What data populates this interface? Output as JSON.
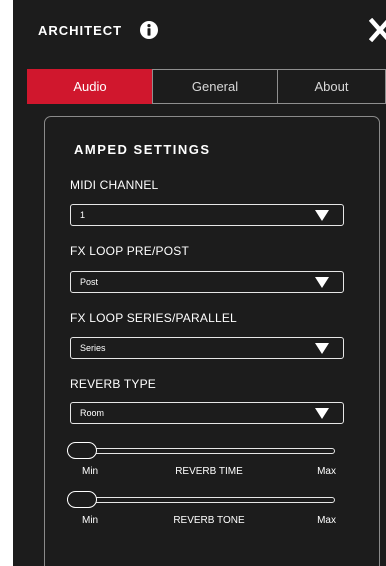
{
  "header": {
    "title": "ARCHITECT",
    "info_icon": "info-icon",
    "close_icon": "close-icon"
  },
  "tabs": [
    {
      "label": "Audio",
      "active": true
    },
    {
      "label": "General",
      "active": false
    },
    {
      "label": "About",
      "active": false
    }
  ],
  "colors": {
    "accent": "#d0172d",
    "background": "#1c1c1c",
    "border": "#8a8a8a",
    "text": "#ffffff"
  },
  "section": {
    "title": "AMPED SETTINGS",
    "fields": [
      {
        "label": "MIDI CHANNEL",
        "value": "1"
      },
      {
        "label": "FX LOOP PRE/POST",
        "value": "Post"
      },
      {
        "label": "FX LOOP SERIES/PARALLEL",
        "value": "Series"
      },
      {
        "label": "REVERB TYPE",
        "value": "Room"
      }
    ],
    "sliders": [
      {
        "label": "REVERB TIME",
        "min_label": "Min",
        "max_label": "Max",
        "level": 0
      },
      {
        "label": "REVERB TONE",
        "min_label": "Min",
        "max_label": "Max",
        "level": 0
      }
    ]
  }
}
